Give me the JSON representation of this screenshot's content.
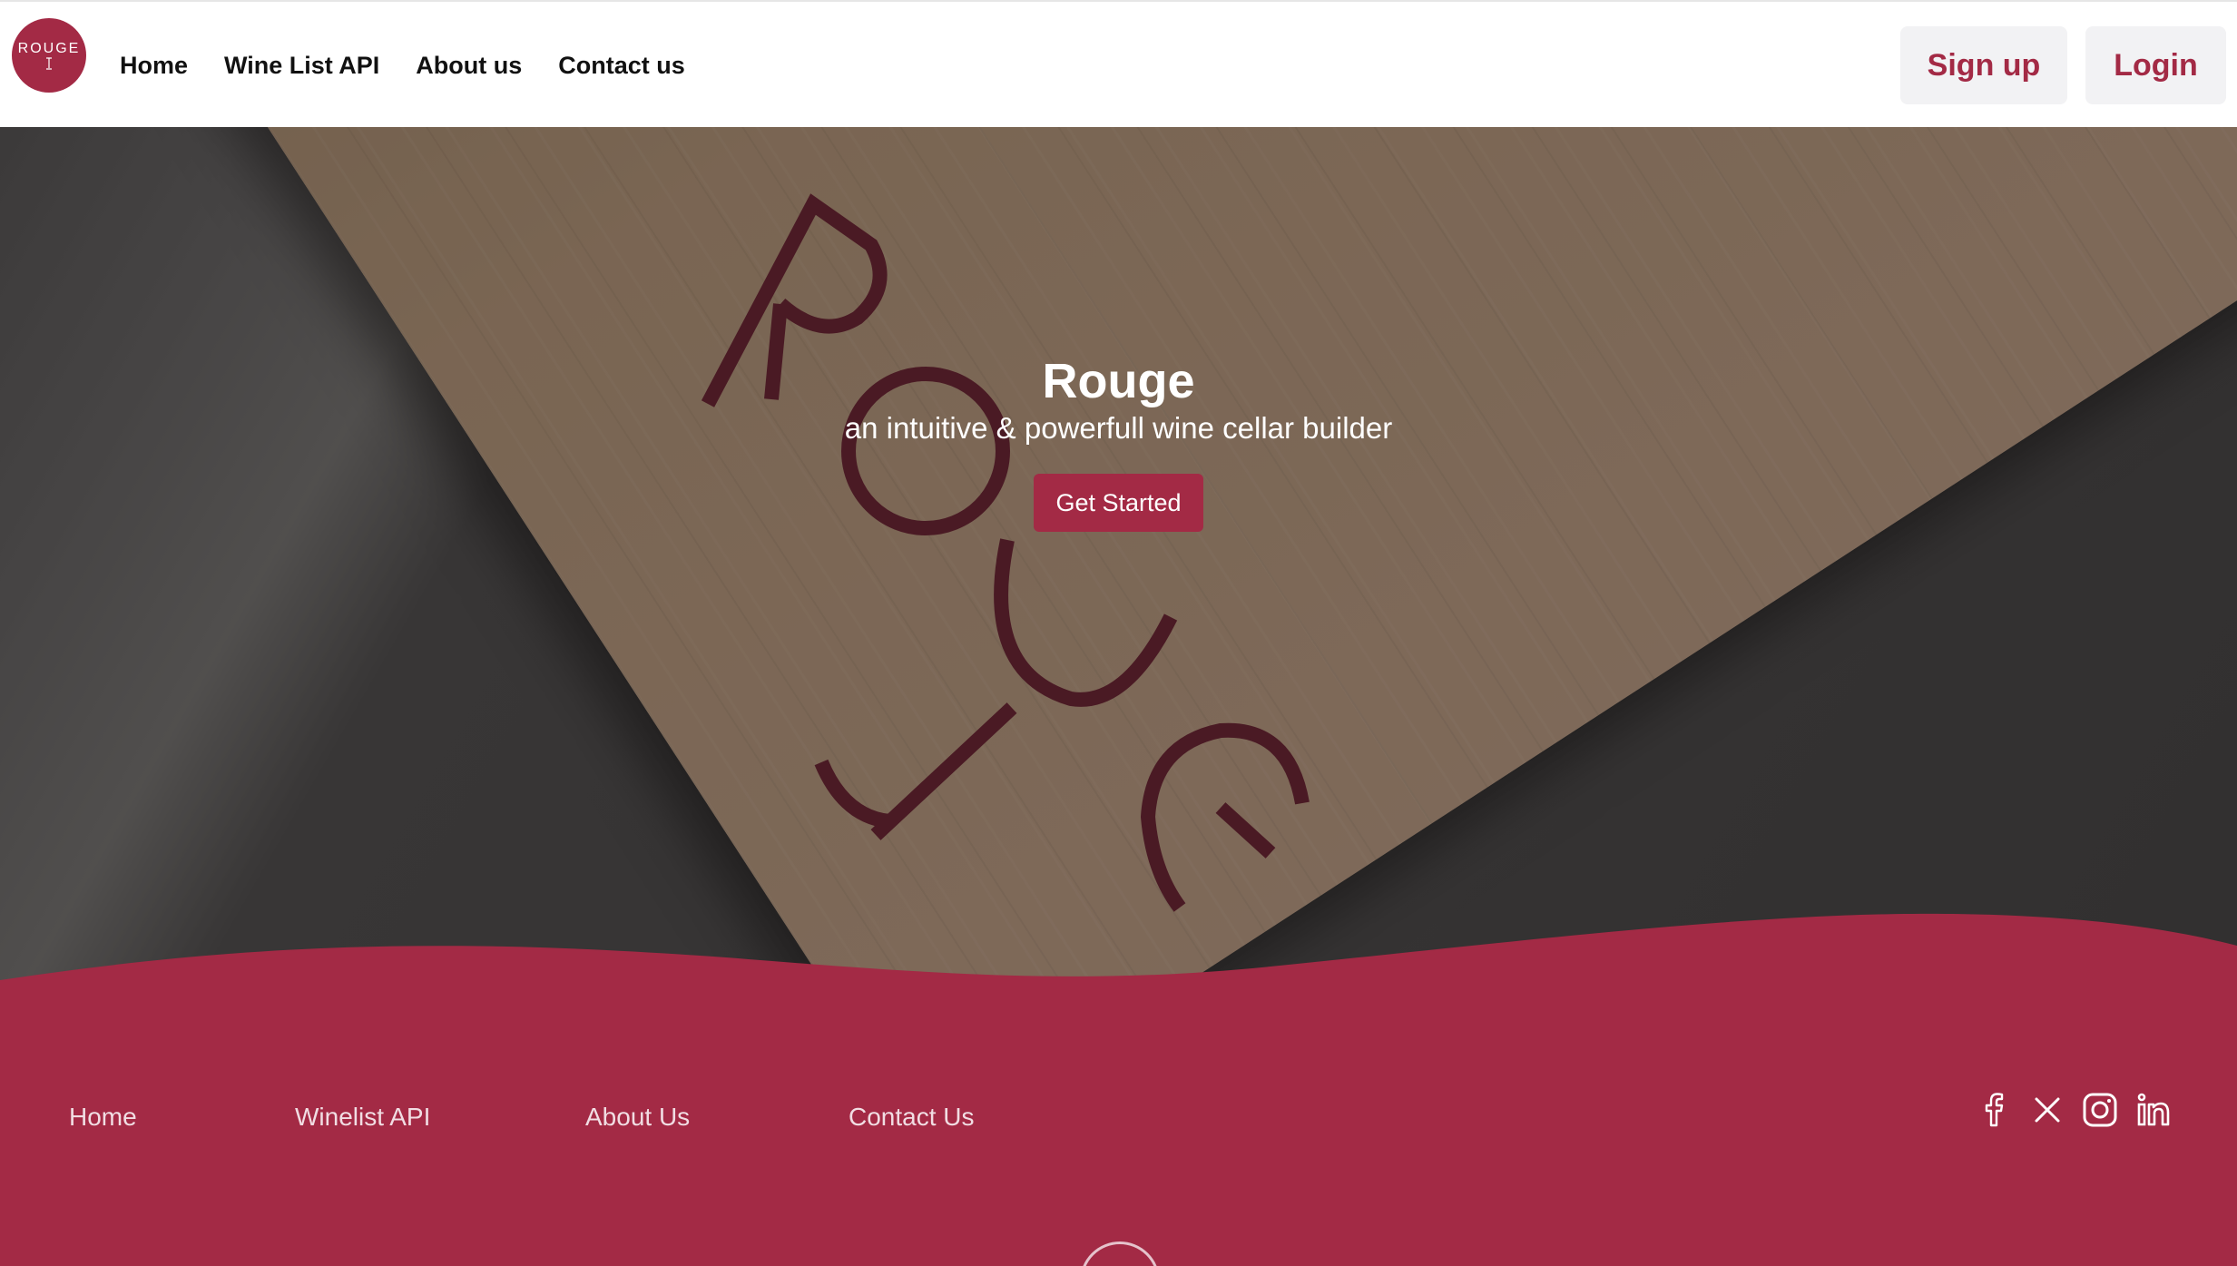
{
  "brand": {
    "logo_text": "ROUGE",
    "accent_color": "#a32a45",
    "logo_icon": "wine-glass-icon"
  },
  "nav": {
    "items": [
      {
        "label": "Home"
      },
      {
        "label": "Wine List API"
      },
      {
        "label": "About us"
      },
      {
        "label": "Contact us"
      }
    ]
  },
  "auth": {
    "signup_label": "Sign up",
    "login_label": "Login"
  },
  "hero": {
    "title": "Rouge",
    "subtitle": "an intuitive & powerfull wine cellar builder",
    "cta_label": "Get Started",
    "watermark_text": "ROUGE"
  },
  "footer": {
    "links": [
      {
        "label": "Home"
      },
      {
        "label": "Winelist API"
      },
      {
        "label": "About Us"
      },
      {
        "label": "Contact Us"
      }
    ],
    "social_icons": [
      "facebook-icon",
      "x-icon",
      "instagram-icon",
      "linkedin-icon"
    ]
  }
}
